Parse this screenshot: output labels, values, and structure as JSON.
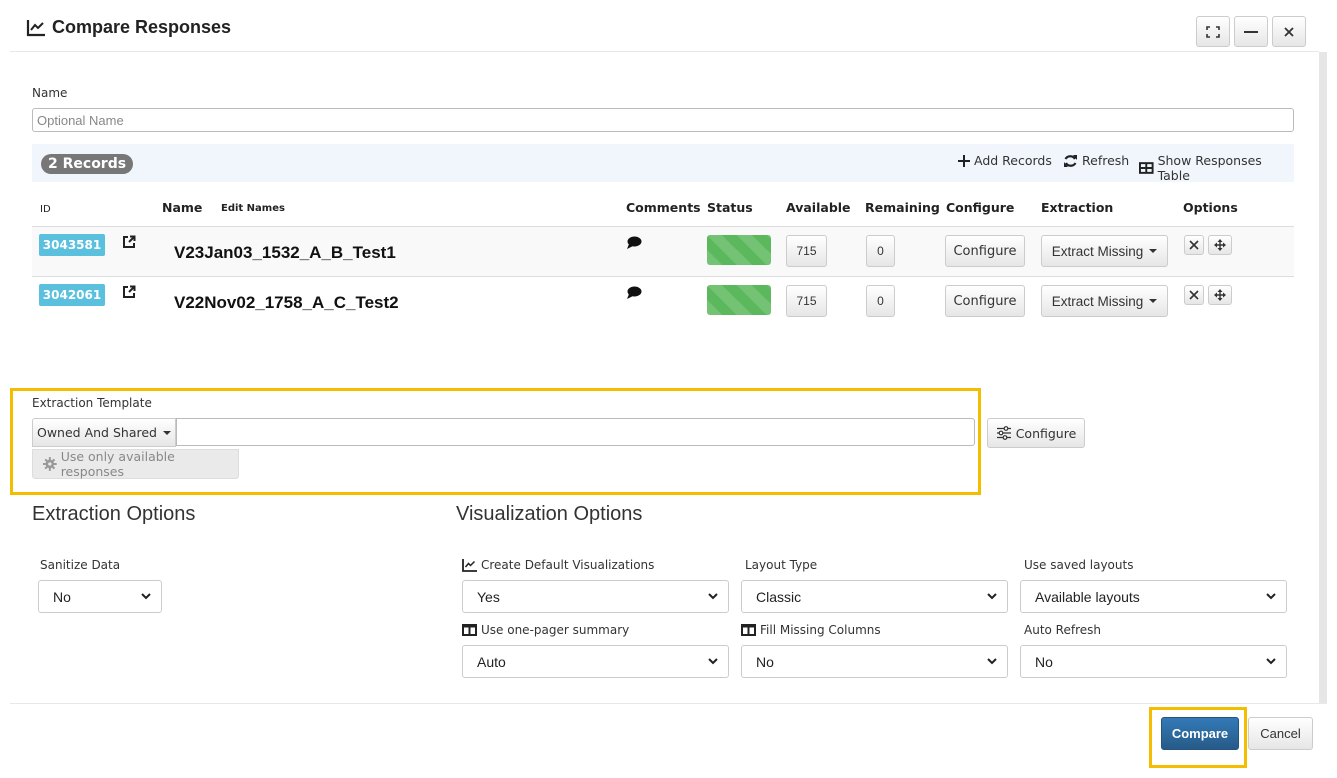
{
  "window": {
    "title": "Compare Responses",
    "title_icon": "line-chart-icon",
    "controls": [
      "maximize-icon",
      "minimize-icon",
      "close-icon"
    ]
  },
  "name_field": {
    "label": "Name",
    "placeholder": "Optional Name",
    "value": ""
  },
  "records_bar": {
    "count_badge": "2 Records",
    "add_records": "Add Records",
    "refresh": "Refresh",
    "show_table": "Show Responses Table"
  },
  "table": {
    "headers": {
      "id": "ID",
      "name": "Name",
      "edit_names": "Edit Names",
      "comments": "Comments",
      "status": "Status",
      "available": "Available",
      "remaining": "Remaining",
      "configure": "Configure",
      "extraction": "Extraction",
      "options": "Options"
    },
    "rows": [
      {
        "id": "3043581",
        "name": "V23Jan03_1532_A_B_Test1",
        "status_color": "#5cb85c",
        "status_progress": 1.0,
        "available": "715",
        "remaining": "0",
        "configure_label": "Configure",
        "extraction_label": "Extract Missing"
      },
      {
        "id": "3042061",
        "name": "V22Nov02_1758_A_C_Test2",
        "status_color": "#5cb85c",
        "status_progress": 1.0,
        "available": "715",
        "remaining": "0",
        "configure_label": "Configure",
        "extraction_label": "Extract Missing"
      }
    ]
  },
  "extraction_template": {
    "label": "Extraction Template",
    "scope_dropdown": "Owned And Shared",
    "template_value": "",
    "use_available_label": "Use only available responses",
    "configure_label": "Configure"
  },
  "extraction_options": {
    "heading": "Extraction Options",
    "sanitize_label": "Sanitize Data",
    "sanitize_value": "No"
  },
  "visualization_options": {
    "heading": "Visualization Options",
    "create_default_label": "Create Default Visualizations",
    "create_default_value": "Yes",
    "layout_type_label": "Layout Type",
    "layout_type_value": "Classic",
    "saved_layouts_label": "Use saved layouts",
    "saved_layouts_value": "Available layouts",
    "one_pager_label": "Use one-pager summary",
    "one_pager_value": "Auto",
    "fill_missing_label": "Fill Missing Columns",
    "fill_missing_value": "No",
    "auto_refresh_label": "Auto Refresh",
    "auto_refresh_value": "No"
  },
  "footer": {
    "compare_label": "Compare",
    "cancel_label": "Cancel"
  },
  "colors": {
    "primary": "#337ab7",
    "info_badge": "#5bc0de",
    "success": "#5cb85c",
    "highlight": "#f5bd00"
  }
}
